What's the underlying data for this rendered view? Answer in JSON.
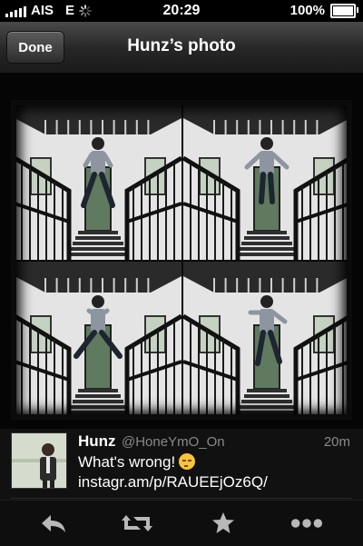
{
  "status_bar": {
    "carrier": "AIS",
    "network": "E",
    "time": "20:29",
    "battery_text": "100%",
    "battery_level": 1.0
  },
  "nav": {
    "done_label": "Done",
    "title": "Hunz’s photo"
  },
  "tweet": {
    "name": "Hunz",
    "handle": "@HoneYmO_On",
    "time": "20m",
    "text": "What's wrong!",
    "emoji": "unamused-face-emoji",
    "link": "instagr.am/p/RAUEEjOz6Q/"
  },
  "toolbar": {
    "icons": [
      "reply-icon",
      "retweet-icon",
      "favorite-star-icon",
      "more-icon"
    ]
  },
  "colors": {
    "nav_top": "#4a4a4a",
    "nav_bottom": "#1a1a1a",
    "secondary_text": "#8a8a8a",
    "toolbar_icon": "#b8b8b8"
  }
}
